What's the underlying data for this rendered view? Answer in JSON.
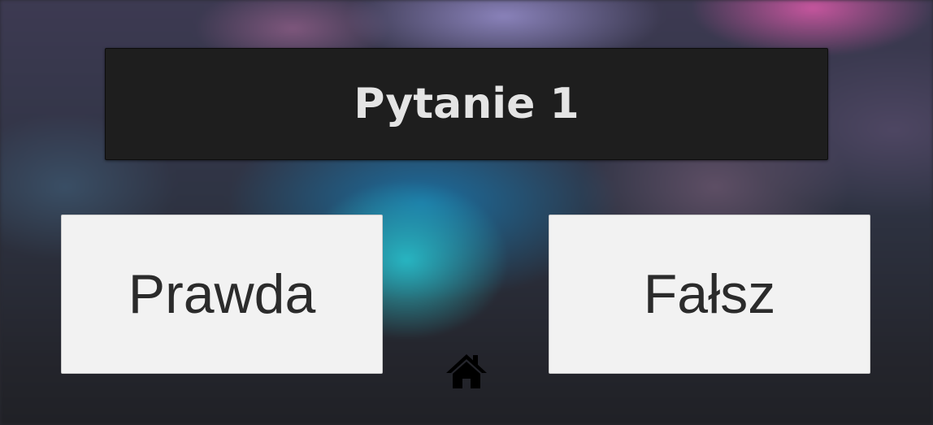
{
  "question": {
    "title": "Pytanie 1"
  },
  "answers": {
    "true_label": "Prawda",
    "false_label": "Fałsz"
  },
  "navigation": {
    "home_icon": "home-icon"
  },
  "colors": {
    "question_bg": "#1e1e1e",
    "question_text": "#e4e4e4",
    "answer_bg": "#f2f2f2",
    "answer_text": "#2b2b2b",
    "icon": "#000000"
  }
}
